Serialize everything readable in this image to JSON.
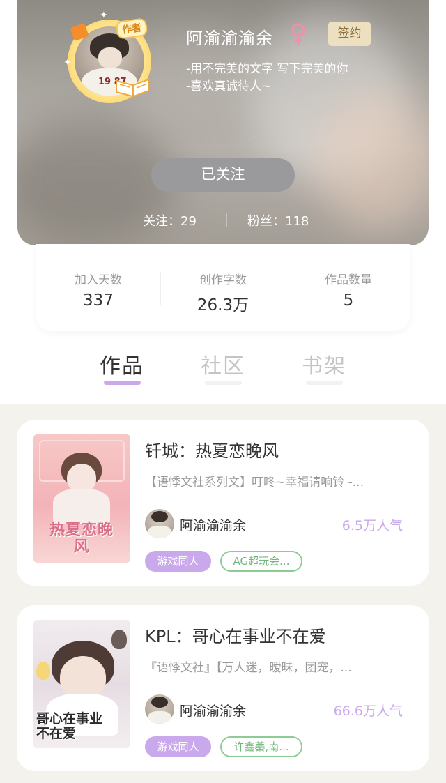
{
  "profile": {
    "author_badge": "作者",
    "avatar_shirt_text": "19 87",
    "username": "阿渝渝渝余",
    "gender_icon": "female-icon",
    "sign_badge": "签约",
    "bio_line1": "-用不完美的文字 写下完美的你",
    "bio_line2": "-喜欢真诚待人~",
    "follow_button": "已关注",
    "following_text": "关注：29",
    "fans_text": "粉丝：118"
  },
  "metrics": [
    {
      "label": "加入天数",
      "value": "337"
    },
    {
      "label": "创作字数",
      "value": "26.3万"
    },
    {
      "label": "作品数量",
      "value": "5"
    }
  ],
  "tabs": [
    {
      "label": "作品",
      "active": true
    },
    {
      "label": "社区",
      "active": false
    },
    {
      "label": "书架",
      "active": false
    }
  ],
  "works": [
    {
      "cover_text": "热夏恋晚风",
      "title": "钎城：热夏恋晚风",
      "description": "【语悸文社系列文】叮咚~幸福请响铃 -...",
      "author": "阿渝渝渝余",
      "popularity": "6.5万人气",
      "tag_genre": "游戏同人",
      "tag_fandom": "AG超玩会..."
    },
    {
      "cover_text": "哥心在事业不在爱",
      "title": "KPL：哥心在事业不在爱",
      "description": "『语悸文社』【万人迷，暧昧，团宠，...",
      "author": "阿渝渝渝余",
      "popularity": "66.6万人气",
      "tag_genre": "游戏同人",
      "tag_fandom": "许鑫蓁,南..."
    }
  ],
  "colors": {
    "accent_purple": "#c9a9ec",
    "tag_green": "#8dcc95",
    "sign_badge_bg": "#ede0c0",
    "page_bg": "#f3f2ed"
  }
}
